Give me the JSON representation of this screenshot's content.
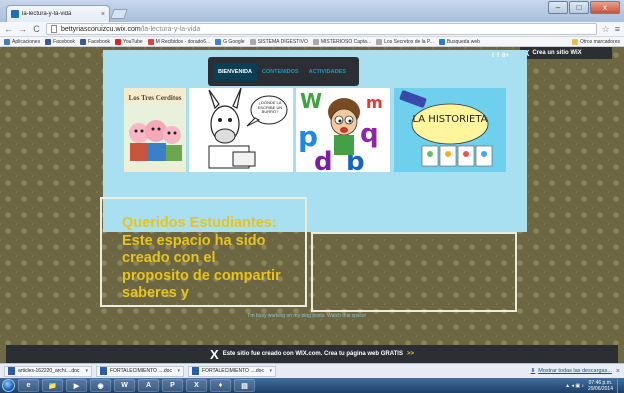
{
  "browser": {
    "tab_title": "la-lectura-y-la-vida",
    "tab_close": "×",
    "back": "←",
    "forward": "→",
    "reload": "C",
    "url_host": "bettyriascoruizcu.wix.com",
    "url_path": "/la-lectura-y-la-vida",
    "star": "☆",
    "menu": "≡",
    "window_controls": [
      "–",
      "□",
      "x"
    ],
    "bookmarks": [
      {
        "label": "Aplicaciones",
        "color": "#4a78c2"
      },
      {
        "label": "Facebook",
        "color": "#3b5998"
      },
      {
        "label": "Facebook",
        "color": "#3b5998"
      },
      {
        "label": "YouTube",
        "color": "#d22"
      },
      {
        "label": "M Recibidos - dorado6...",
        "color": "#d44"
      },
      {
        "label": "G Google",
        "color": "#3c7de0"
      },
      {
        "label": "SISTEMA DIGESTIVO",
        "color": "#aaa"
      },
      {
        "label": "MISTERIOSO Capta...",
        "color": "#aaa"
      },
      {
        "label": "Los Secretos de la P...",
        "color": "#aaa"
      },
      {
        "label": "Busqueda web",
        "color": "#2a7bd8"
      }
    ],
    "other_bookmarks": "Otros marcadores"
  },
  "site": {
    "wix_banner": "Crea un sitio WiX",
    "wix_banner_close": "X",
    "nav_tabs": [
      "BIENVENIDA",
      "CONTENIDOS",
      "ACTIVIDADES"
    ],
    "social": [
      "t",
      "f",
      "8+"
    ],
    "tile1_title": "Los Tres Cerditos",
    "tile2_speech": "¿DÓNDE LA ESCRIBE UN BURRO?",
    "tile4_title": "LA HISTORIETA",
    "welcome_text": "Queridos Estudiantes: Este espacio  ha sido creado con el proposito de compartir  saberes y",
    "placeholder_note": "I'm busy working on my blog posts. Watch this space!",
    "wix_footer": "Este sitio fue creado con WIX.com. Crea tu página web GRATIS",
    "wix_footer_arrow": ">>"
  },
  "downloads": {
    "items": [
      "articles-162220_archi....doc",
      "FORTALECIMIENTO ....doc",
      "FORTALECIMIENTO ....doc"
    ],
    "show_all": "Mostrar todas las descargas...",
    "close": "×"
  },
  "taskbar": {
    "apps": [
      "e",
      "📁",
      "▶",
      "◉",
      "W",
      "A",
      "P",
      "X",
      "♦",
      "▤"
    ],
    "time": "07:46 p.m.",
    "date": "29/06/2014"
  }
}
